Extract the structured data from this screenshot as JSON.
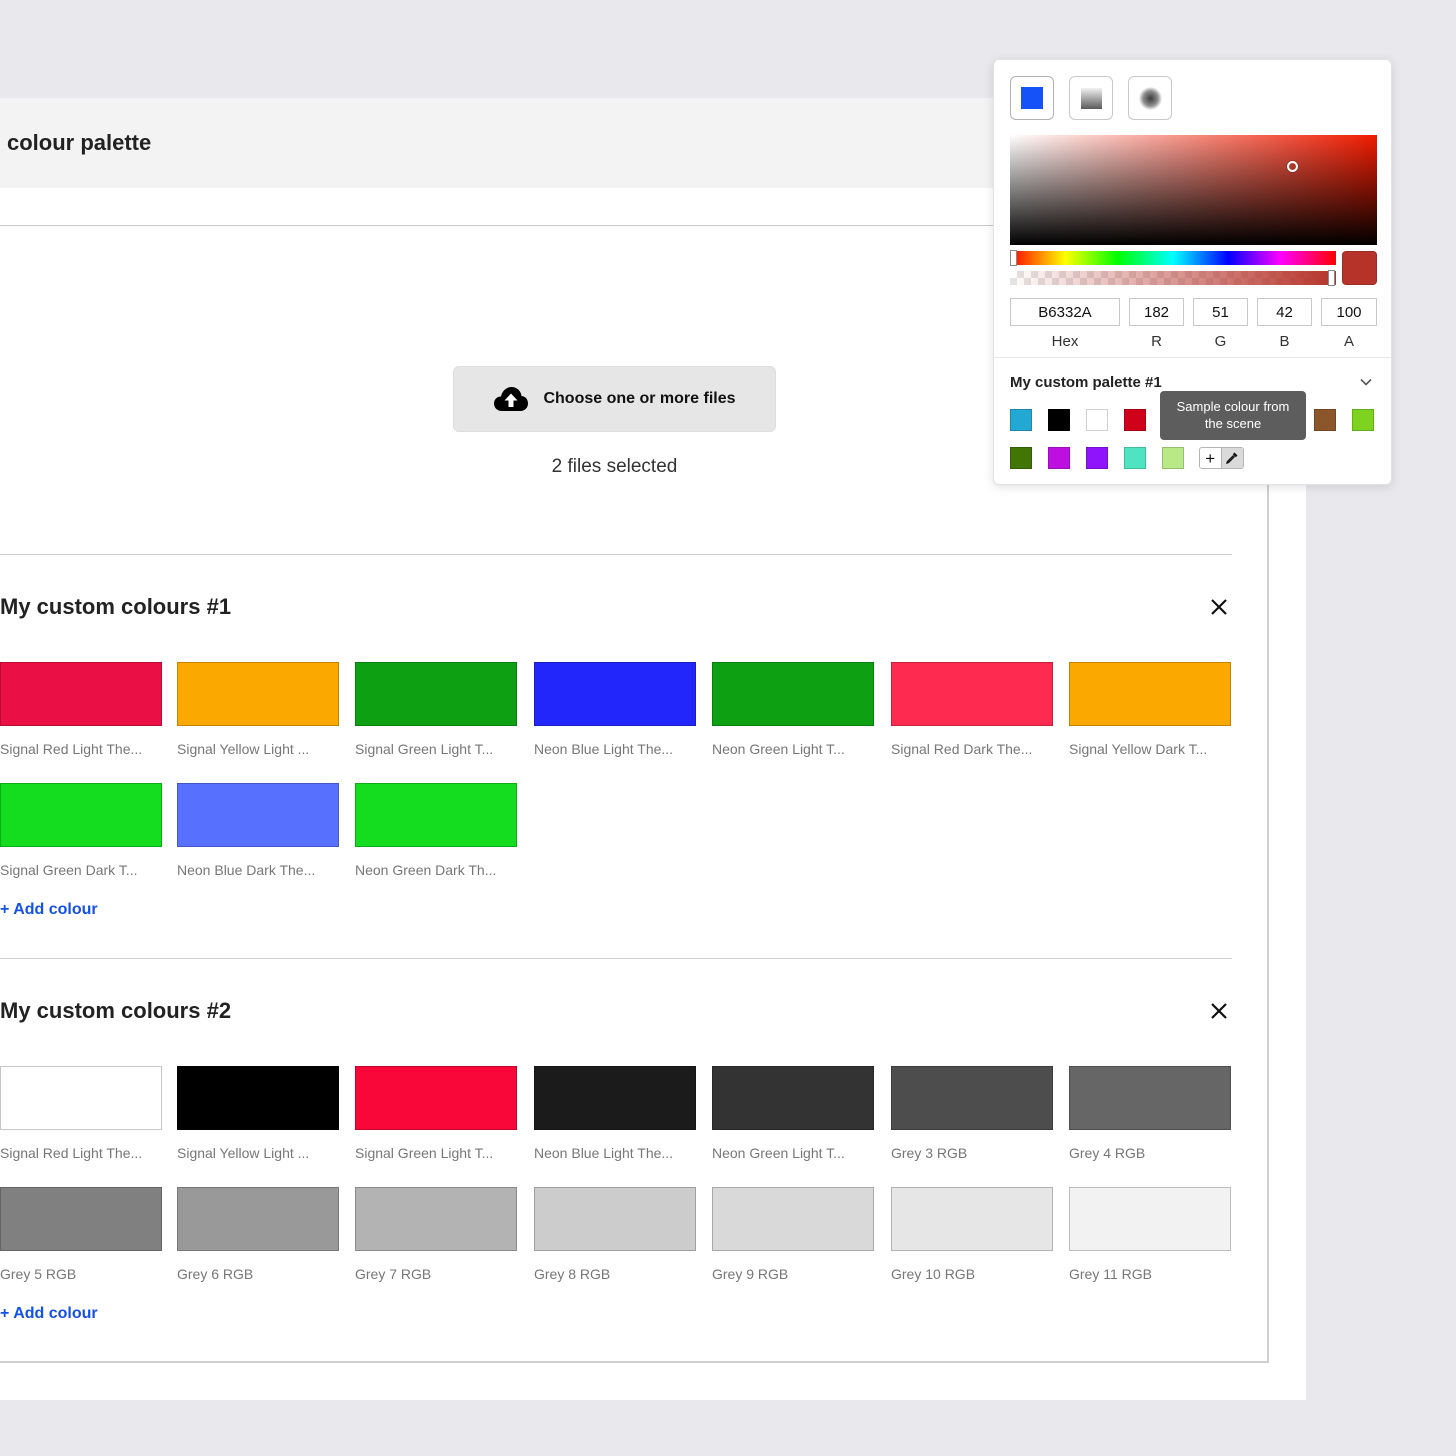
{
  "header": {
    "title": "colour palette"
  },
  "upload": {
    "button_label": "Choose one or more files",
    "status": "2 files selected"
  },
  "sections": [
    {
      "title": "My custom colours #1",
      "add_label": "+ Add colour",
      "swatches": [
        {
          "label": "Signal Red Light The...",
          "color": "#ea1045"
        },
        {
          "label": "Signal Yellow Light ...",
          "color": "#fba800"
        },
        {
          "label": "Signal Green Light T...",
          "color": "#0ca012"
        },
        {
          "label": "Neon Blue Light The...",
          "color": "#2326fb"
        },
        {
          "label": "Neon Green Light T...",
          "color": "#0ca012"
        },
        {
          "label": "Signal Red Dark The...",
          "color": "#ff2a4f"
        },
        {
          "label": "Signal Yellow Dark T...",
          "color": "#fba800"
        },
        {
          "label": "Signal Green Dark T...",
          "color": "#14dc1e"
        },
        {
          "label": "Neon Blue Dark The...",
          "color": "#5870fe"
        },
        {
          "label": "Neon Green Dark Th...",
          "color": "#14dc1e"
        }
      ]
    },
    {
      "title": "My custom colours #2",
      "add_label": "+ Add colour",
      "swatches": [
        {
          "label": "Signal Red Light The...",
          "color": "#ffffff"
        },
        {
          "label": "Signal Yellow Light ...",
          "color": "#000000"
        },
        {
          "label": "Signal Green Light T...",
          "color": "#f90739"
        },
        {
          "label": "Neon Blue Light The...",
          "color": "#1b1b1b"
        },
        {
          "label": "Neon Green Light T...",
          "color": "#333333"
        },
        {
          "label": "Grey 3 RGB",
          "color": "#4d4d4d"
        },
        {
          "label": "Grey 4 RGB",
          "color": "#666666"
        },
        {
          "label": "Grey 5 RGB",
          "color": "#808080"
        },
        {
          "label": "Grey 6 RGB",
          "color": "#999999"
        },
        {
          "label": "Grey 7 RGB",
          "color": "#b3b3b3"
        },
        {
          "label": "Grey 8 RGB",
          "color": "#cccccc"
        },
        {
          "label": "Grey 9 RGB",
          "color": "#d9d9d9"
        },
        {
          "label": "Grey 10 RGB",
          "color": "#e6e6e6"
        },
        {
          "label": "Grey 11 RGB",
          "color": "#f2f2f2"
        }
      ]
    }
  ],
  "picker": {
    "current_color": "#b6332a",
    "hex": "B6332A",
    "r": "182",
    "g": "51",
    "b": "42",
    "a": "100",
    "labels": {
      "hex": "Hex",
      "r": "R",
      "g": "G",
      "b": "B",
      "a": "A"
    },
    "palette_name": "My custom palette #1",
    "tooltip": "Sample colour from the scene",
    "add_symbol": "+",
    "palette_colors": [
      [
        "#22a8d3",
        "#000000",
        "#ffffff",
        "#d0021b",
        "#a0a0a0",
        "#7e5228",
        "#8b572a",
        "#7ed321"
      ],
      [
        "#417505",
        "#bd10e0",
        "#9013fe",
        "#50e3c2",
        "#b8e986"
      ]
    ]
  }
}
